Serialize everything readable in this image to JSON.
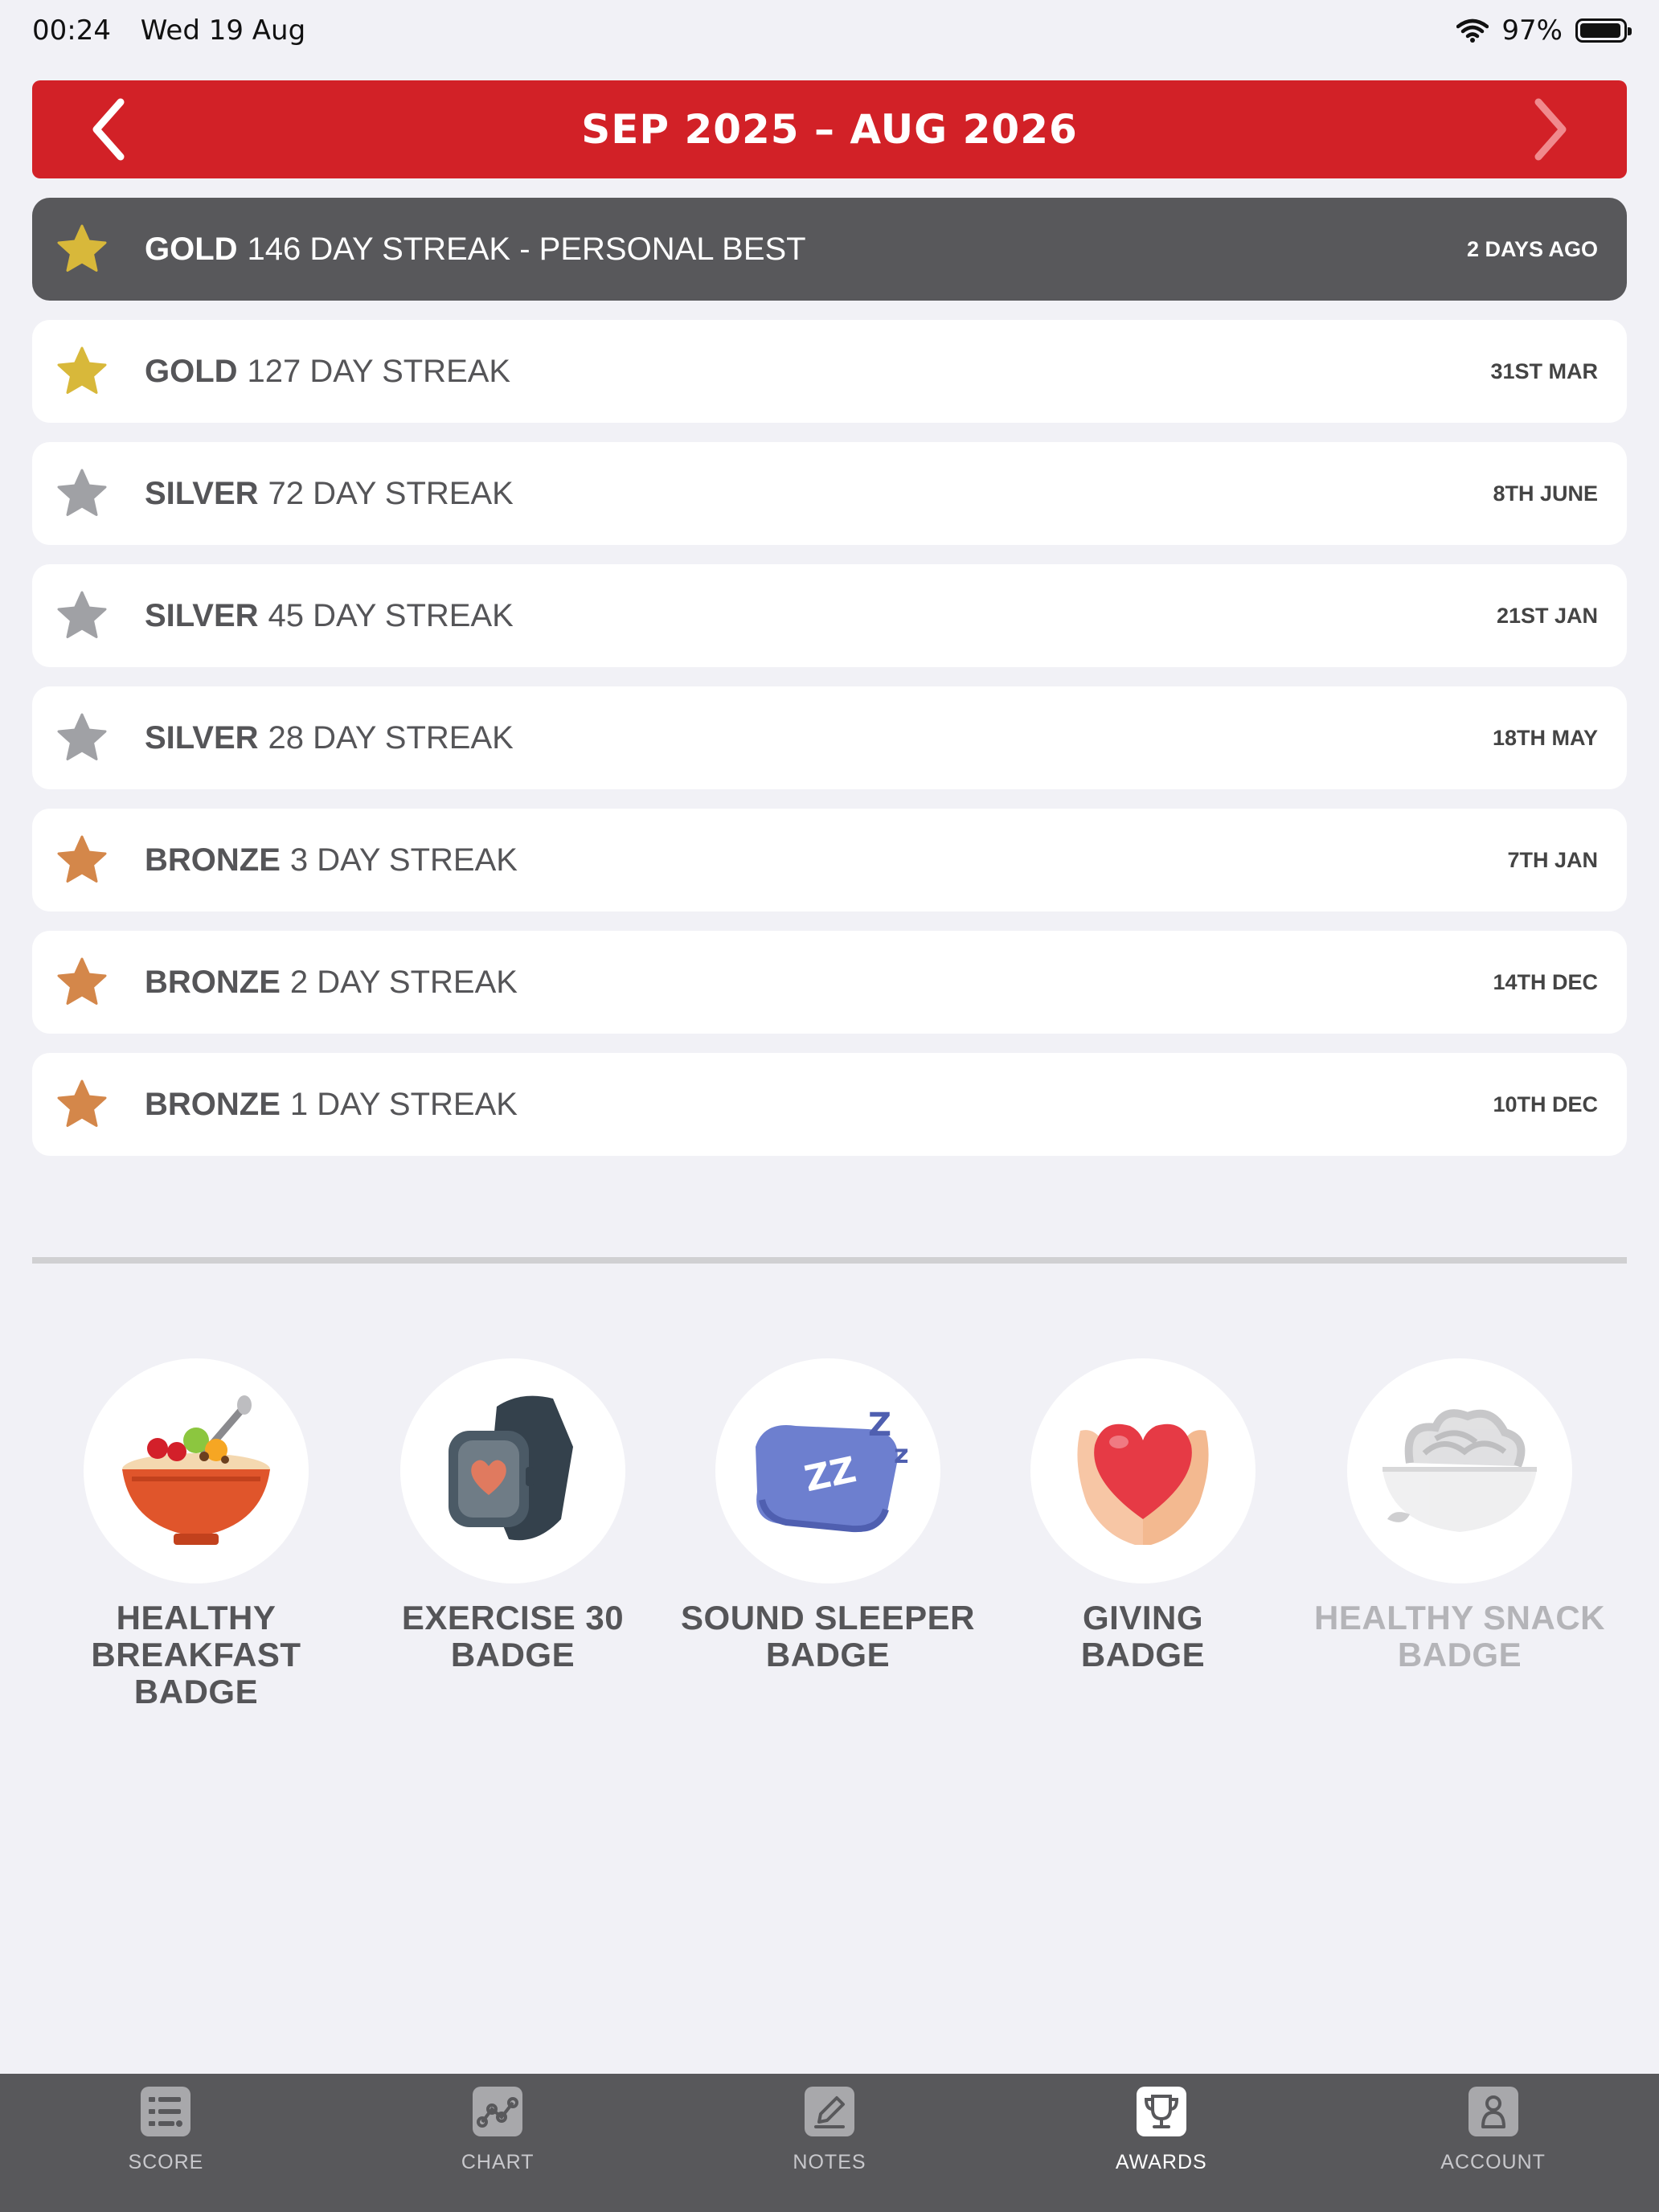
{
  "status_bar": {
    "time": "00:24",
    "date": "Wed 19 Aug",
    "battery": "97%"
  },
  "header": {
    "period": "SEP 2025 – AUG 2026"
  },
  "streaks": [
    {
      "tier": "GOLD",
      "text": "146 DAY STREAK - PERSONAL BEST",
      "date": "2 DAYS AGO",
      "color": "#d8b83a",
      "highlight": true
    },
    {
      "tier": "GOLD",
      "text": "127 DAY STREAK",
      "date": "31ST MAR",
      "color": "#d8b83a"
    },
    {
      "tier": "SILVER",
      "text": "72 DAY STREAK",
      "date": "8TH JUNE",
      "color": "#a0a1a5"
    },
    {
      "tier": "SILVER",
      "text": "45 DAY STREAK",
      "date": "21ST JAN",
      "color": "#a0a1a5"
    },
    {
      "tier": "SILVER",
      "text": "28 DAY STREAK",
      "date": "18TH MAY",
      "color": "#a0a1a5"
    },
    {
      "tier": "BRONZE",
      "text": "3 DAY STREAK",
      "date": "7TH JAN",
      "color": "#d4874a"
    },
    {
      "tier": "BRONZE",
      "text": "2 DAY STREAK",
      "date": "14TH DEC",
      "color": "#d4874a"
    },
    {
      "tier": "BRONZE",
      "text": "1 DAY STREAK",
      "date": "10TH DEC",
      "color": "#d4874a"
    }
  ],
  "badges": [
    {
      "line1": "HEALTHY",
      "line2": "BREAKFAST BADGE",
      "icon": "cereal-bowl-icon"
    },
    {
      "line1": "EXERCISE 30",
      "line2": "BADGE",
      "icon": "smartwatch-icon"
    },
    {
      "line1": "SOUND SLEEPER",
      "line2": "BADGE",
      "icon": "pillow-icon"
    },
    {
      "line1": "GIVING",
      "line2": "BADGE",
      "icon": "heart-hands-icon"
    },
    {
      "line1": "HEALTHY SNACK",
      "line2": "BADGE",
      "icon": "noodle-bowl-icon",
      "locked": true
    }
  ],
  "tabs": [
    {
      "label": "SCORE",
      "icon": "score-list-icon"
    },
    {
      "label": "CHART",
      "icon": "chart-line-icon"
    },
    {
      "label": "NOTES",
      "icon": "pencil-icon"
    },
    {
      "label": "AWARDS",
      "icon": "trophy-icon",
      "active": true
    },
    {
      "label": "ACCOUNT",
      "icon": "account-icon"
    }
  ],
  "colors": {
    "accent": "#d22127",
    "tab_bar": "#58585b",
    "highlight_row": "#58585b"
  }
}
